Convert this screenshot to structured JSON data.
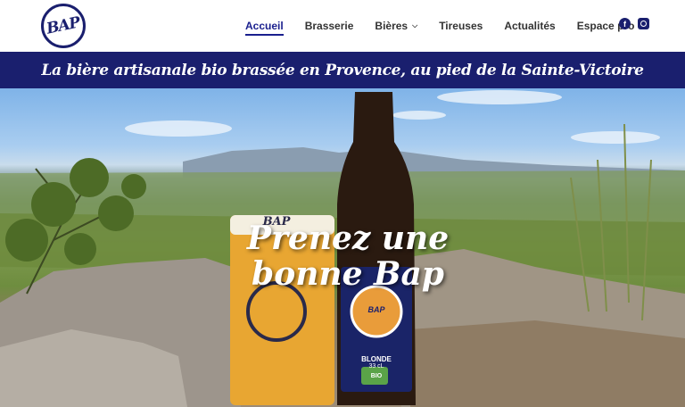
{
  "header": {
    "logo_text": "BAP",
    "nav": [
      {
        "label": "Accueil",
        "active": true
      },
      {
        "label": "Brasserie"
      },
      {
        "label": "Bières",
        "has_dropdown": true
      },
      {
        "label": "Tireuses"
      },
      {
        "label": "Actualités"
      },
      {
        "label": "Espace pro"
      }
    ],
    "social": {
      "facebook_icon": "facebook-icon",
      "instagram_icon": "instagram-icon"
    }
  },
  "banner": {
    "text": "La bière artisanale bio brassée en Provence, au pied de la Sainte-Victoire"
  },
  "hero": {
    "headline_line1": "Prenez une",
    "headline_line2": "bonne Bap",
    "glass_logo": "BAP",
    "bottle_label_logo": "BAP",
    "bottle_label_style": "BLONDE",
    "bottle_label_volume": "33 cL",
    "bottle_label_bio": "BIO"
  },
  "colors": {
    "brand_navy": "#1a1f6e",
    "nav_text": "#333333",
    "active_nav": "#1a1f8e"
  }
}
